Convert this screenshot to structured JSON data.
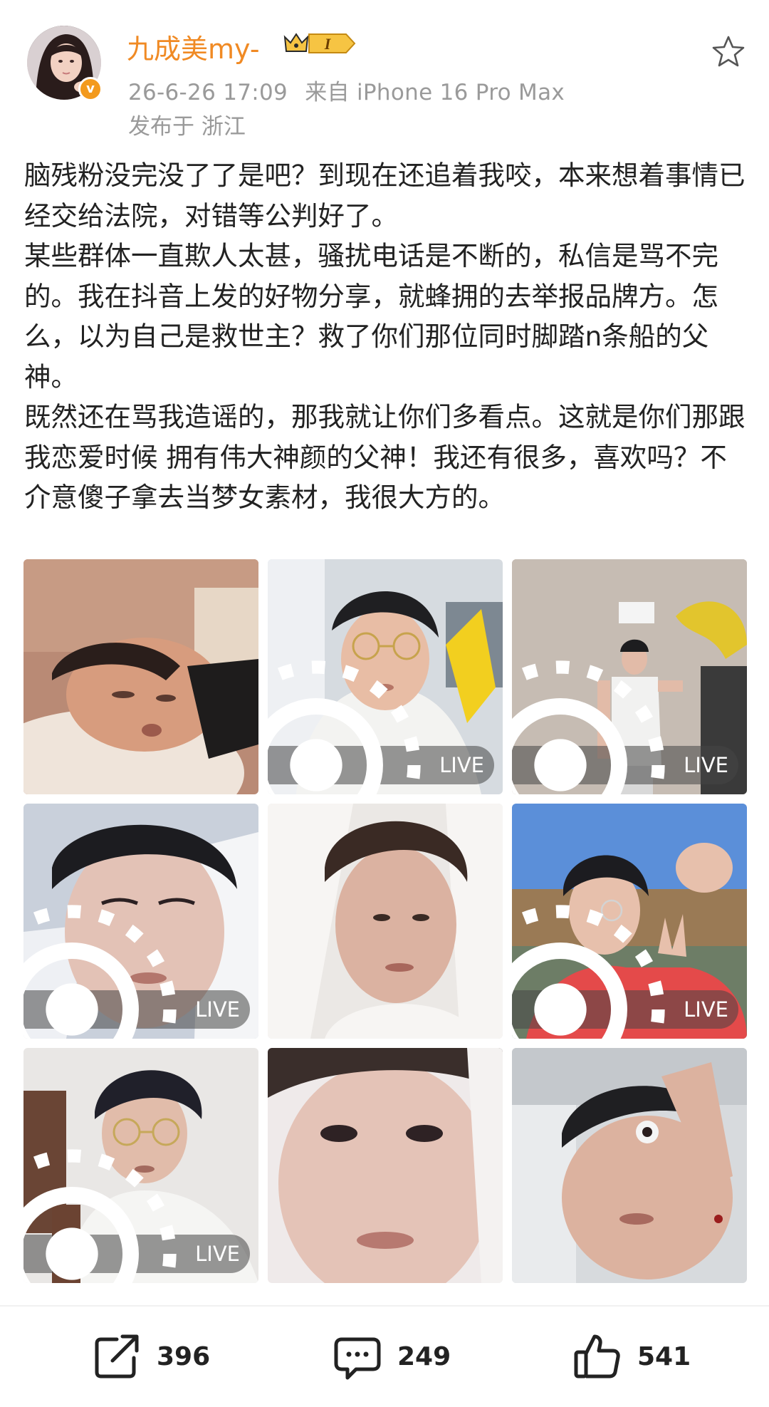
{
  "user": {
    "name": "九成美my-",
    "vip_level": "I",
    "datetime": "26-6-26 17:09",
    "source": "来自 iPhone 16 Pro Max",
    "location": "发布于 浙江"
  },
  "post": {
    "text": "脑残粉没完没了了是吧？到现在还追着我咬，本来想着事情已经交给法院，对错等公判好了。\n某些群体一直欺人太甚，骚扰电话是不断的，私信是骂不完的。我在抖音上发的好物分享，就蜂拥的去举报品牌方。怎么，以为自己是救世主？救了你们那位同时脚踏n条船的父神。\n既然还在骂我造谣的，那我就让你们多看点。这就是你们那跟我恋爱时候 拥有伟大神颜的父神！我还有很多，喜欢吗？不介意傻子拿去当梦女素材，我很大方的。"
  },
  "photos": [
    {
      "live": false
    },
    {
      "live": true,
      "label": "LIVE"
    },
    {
      "live": true,
      "label": "LIVE"
    },
    {
      "live": true,
      "label": "LIVE"
    },
    {
      "live": false
    },
    {
      "live": true,
      "label": "LIVE"
    },
    {
      "live": true,
      "label": "LIVE"
    },
    {
      "live": false
    },
    {
      "live": false
    }
  ],
  "actions": {
    "repost_count": "396",
    "comment_count": "249",
    "like_count": "541"
  },
  "colors": {
    "username": "#f08a24",
    "meta": "#9a9a9a",
    "verified": "#f39a1d"
  },
  "icons": [
    "star-icon",
    "verified-icon",
    "vip-badge-icon",
    "live-icon",
    "repost-icon",
    "comment-icon",
    "like-icon"
  ]
}
